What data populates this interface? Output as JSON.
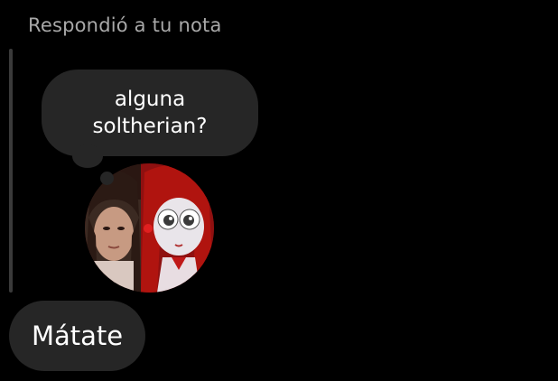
{
  "reply": {
    "header_text": "Respondió a tu nota"
  },
  "note": {
    "text": "alguna soltherian?"
  },
  "avatar": {
    "description": "profile-avatar"
  },
  "message": {
    "text": "Mátate"
  },
  "colors": {
    "background": "#000000",
    "bubble": "#262626",
    "header_text": "#a8a8a8",
    "reply_line": "#3a3a3a"
  }
}
